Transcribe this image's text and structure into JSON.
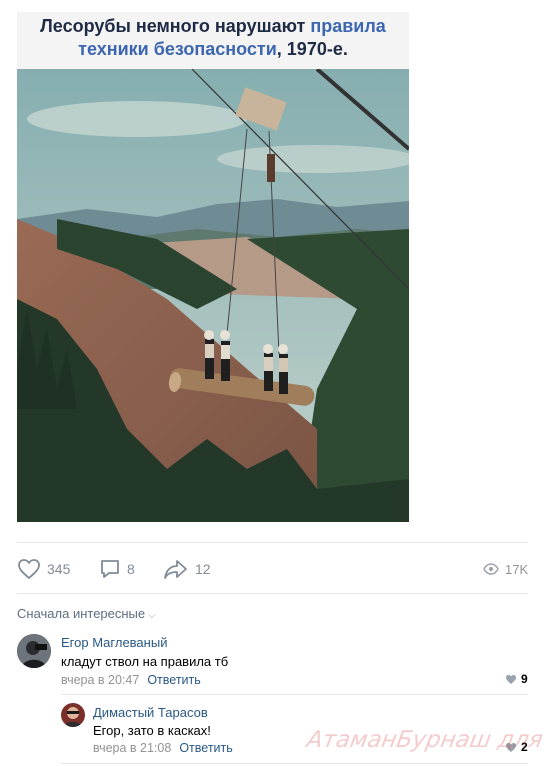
{
  "post": {
    "caption_part1": "Лесорубы немного нарушают ",
    "caption_accent1": "правила",
    "caption_accent2": "техники безопасности",
    "caption_part2": ", 1970-е."
  },
  "actions": {
    "likes": "345",
    "comments": "8",
    "shares": "12",
    "views": "17K",
    "icons": [
      "heart-icon",
      "comment-icon",
      "share-icon",
      "eye-icon"
    ]
  },
  "comments_section": {
    "sort_label": "Сначала интересные"
  },
  "comments": [
    {
      "author": "Егор Маглеваный",
      "text": "кладут ствол на правила тб",
      "time": "вчера в 20:47",
      "reply_label": "Ответить",
      "likes": "9"
    },
    {
      "author": "Димастый Тарасов",
      "text": "Егор, зато в касках!",
      "time": "вчера в 21:08",
      "reply_label": "Ответить",
      "likes": "2"
    }
  ],
  "watermark": "АтаманБурнаш для ЛП",
  "colors": {
    "link": "#2a5885",
    "muted": "#818c99",
    "caption_accent": "#3d66b0"
  }
}
